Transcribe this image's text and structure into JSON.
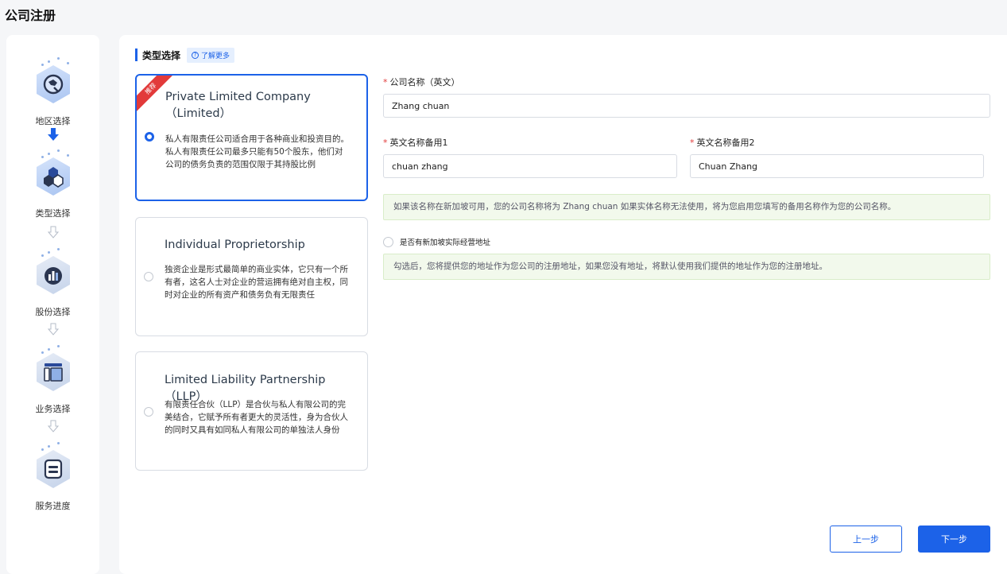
{
  "page": {
    "title": "公司注册"
  },
  "steps": [
    {
      "label": "地区选择",
      "icon": "globe-icon"
    },
    {
      "label": "类型选择",
      "icon": "cubes-icon"
    },
    {
      "label": "股份选择",
      "icon": "chart-icon"
    },
    {
      "label": "业务选择",
      "icon": "layout-icon"
    },
    {
      "label": "服务进度",
      "icon": "document-icon"
    }
  ],
  "section": {
    "title": "类型选择",
    "learn_more": "了解更多"
  },
  "company_types": [
    {
      "title": "Private Limited Company（Limited）",
      "description": "私人有限责任公司适合用于各种商业和投资目的。私人有限责任公司最多只能有50个股东，他们对公司的债务负责的范围仅限于其持股比例",
      "badge": "推荐",
      "selected": true
    },
    {
      "title": "Individual Proprietorship",
      "description": "独资企业是形式最简单的商业实体，它只有一个所有者，这名人士对企业的营运拥有绝对自主权，同时对企业的所有资产和债务负有无限责任",
      "selected": false
    },
    {
      "title": "Limited Liability Partnership（LLP）",
      "description": "有限责任合伙（LLP）是合伙与私人有限公司的完美结合，它赋予所有者更大的灵活性，身为合伙人的同时又具有如同私人有限公司的单独法人身份",
      "selected": false
    }
  ],
  "form": {
    "name_en": {
      "label": "公司名称（英文）",
      "value": "Zhang chuan"
    },
    "alt_name_1": {
      "label": "英文名称备用1",
      "value": "chuan zhang"
    },
    "alt_name_2": {
      "label": "英文名称备用2",
      "value": "Chuan Zhang"
    },
    "name_notice": "如果该名称在新加坡可用，您的公司名称将为 Zhang chuan 如果实体名称无法使用，将为您启用您填写的备用名称作为您的公司名称。",
    "address_option_label": "是否有新加坡实际经营地址",
    "address_notice": "勾选后，您将提供您的地址作为您公司的注册地址，如果您没有地址，将默认使用我们提供的地址作为您的注册地址。"
  },
  "buttons": {
    "prev": "上一步",
    "next": "下一步"
  },
  "colors": {
    "primary": "#1c62e8",
    "danger": "#e23a3a",
    "notice_bg": "#f2f9ec"
  }
}
